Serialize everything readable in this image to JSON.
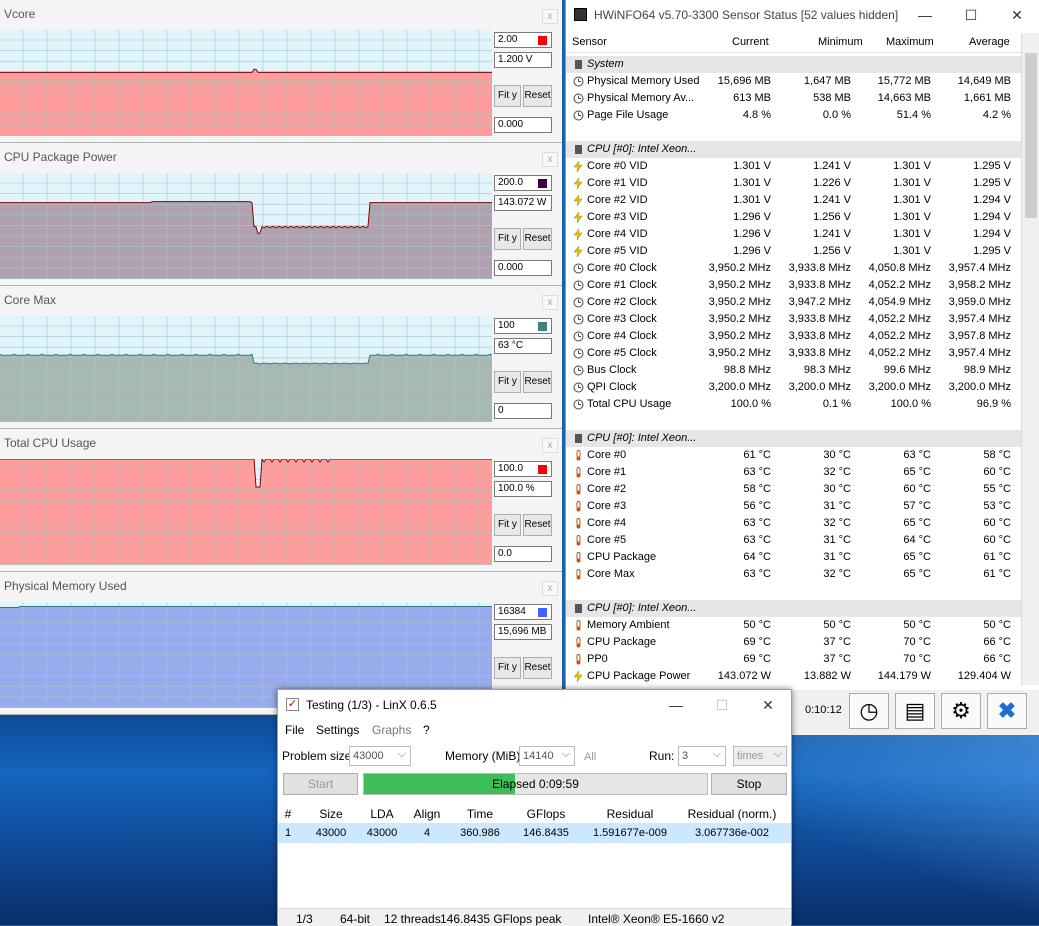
{
  "graphs": [
    {
      "title": "Vcore",
      "max": "2.00",
      "current": "1.200 V",
      "min": "0.000",
      "swatch": "#ff0000",
      "fill": "#ff9c9c",
      "level": 0.6,
      "shape": "vcore"
    },
    {
      "title": "CPU Package Power",
      "max": "200.0",
      "current": "143.072 W",
      "min": "0.000",
      "swatch": "#400040",
      "fill": "#b0a0b0",
      "level": 0.72,
      "shape": "power"
    },
    {
      "title": "Core Max",
      "max": "100",
      "current": "63 °C",
      "min": "0",
      "swatch": "#408080",
      "fill": "#a8b8b0",
      "level": 0.63,
      "shape": "temp"
    },
    {
      "title": "Total CPU Usage",
      "max": "100.0",
      "current": "100.0 %",
      "min": "0.0",
      "swatch": "#ff0000",
      "fill": "#ff9c9c",
      "level": 1.0,
      "shape": "usage"
    },
    {
      "title": "Physical Memory Used",
      "max": "16384",
      "current": "15,696 MB",
      "min": "",
      "swatch": "#4060ff",
      "fill": "#99aaee",
      "level": 0.958,
      "shape": "mem"
    }
  ],
  "graph_buttons": {
    "fit": "Fit y",
    "reset": "Reset",
    "close": "x"
  },
  "hwinfo": {
    "title": "HWiNFO64 v5.70-3300 Sensor Status [52 values hidden]",
    "controls": {
      "min": "—",
      "max": "☐",
      "close": "✕"
    },
    "columns": [
      "Sensor",
      "Current",
      "Minimum",
      "Maximum",
      "Average"
    ],
    "rows": [
      {
        "g": 1,
        "n": "System"
      },
      {
        "i": "clock",
        "n": "Physical Memory Used",
        "c": "15,696 MB",
        "mi": "1,647 MB",
        "ma": "15,772 MB",
        "a": "14,649 MB"
      },
      {
        "i": "clock",
        "n": "Physical Memory Av...",
        "c": "613 MB",
        "mi": "538 MB",
        "ma": "14,663 MB",
        "a": "1,661 MB"
      },
      {
        "i": "clock",
        "n": "Page File Usage",
        "c": "4.8 %",
        "mi": "0.0 %",
        "ma": "51.4 %",
        "a": "4.2 %"
      },
      {
        "e": 1
      },
      {
        "g": 1,
        "n": "CPU [#0]: Intel Xeon..."
      },
      {
        "i": "bolt",
        "n": "Core #0 VID",
        "c": "1.301 V",
        "mi": "1.241 V",
        "ma": "1.301 V",
        "a": "1.295 V"
      },
      {
        "i": "bolt",
        "n": "Core #1 VID",
        "c": "1.301 V",
        "mi": "1.226 V",
        "ma": "1.301 V",
        "a": "1.295 V"
      },
      {
        "i": "bolt",
        "n": "Core #2 VID",
        "c": "1.301 V",
        "mi": "1.241 V",
        "ma": "1.301 V",
        "a": "1.294 V"
      },
      {
        "i": "bolt",
        "n": "Core #3 VID",
        "c": "1.296 V",
        "mi": "1.256 V",
        "ma": "1.301 V",
        "a": "1.294 V"
      },
      {
        "i": "bolt",
        "n": "Core #4 VID",
        "c": "1.296 V",
        "mi": "1.241 V",
        "ma": "1.301 V",
        "a": "1.294 V"
      },
      {
        "i": "bolt",
        "n": "Core #5 VID",
        "c": "1.296 V",
        "mi": "1.256 V",
        "ma": "1.301 V",
        "a": "1.295 V"
      },
      {
        "i": "clock",
        "n": "Core #0 Clock",
        "c": "3,950.2 MHz",
        "mi": "3,933.8 MHz",
        "ma": "4,050.8 MHz",
        "a": "3,957.4 MHz"
      },
      {
        "i": "clock",
        "n": "Core #1 Clock",
        "c": "3,950.2 MHz",
        "mi": "3,933.8 MHz",
        "ma": "4,052.2 MHz",
        "a": "3,958.2 MHz"
      },
      {
        "i": "clock",
        "n": "Core #2 Clock",
        "c": "3,950.2 MHz",
        "mi": "3,947.2 MHz",
        "ma": "4,054.9 MHz",
        "a": "3,959.0 MHz"
      },
      {
        "i": "clock",
        "n": "Core #3 Clock",
        "c": "3,950.2 MHz",
        "mi": "3,933.8 MHz",
        "ma": "4,052.2 MHz",
        "a": "3,957.4 MHz"
      },
      {
        "i": "clock",
        "n": "Core #4 Clock",
        "c": "3,950.2 MHz",
        "mi": "3,933.8 MHz",
        "ma": "4,052.2 MHz",
        "a": "3,957.8 MHz"
      },
      {
        "i": "clock",
        "n": "Core #5 Clock",
        "c": "3,950.2 MHz",
        "mi": "3,933.8 MHz",
        "ma": "4,052.2 MHz",
        "a": "3,957.4 MHz"
      },
      {
        "i": "clock",
        "n": "Bus Clock",
        "c": "98.8 MHz",
        "mi": "98.3 MHz",
        "ma": "99.6 MHz",
        "a": "98.9 MHz"
      },
      {
        "i": "clock",
        "n": "QPI Clock",
        "c": "3,200.0 MHz",
        "mi": "3,200.0 MHz",
        "ma": "3,200.0 MHz",
        "a": "3,200.0 MHz"
      },
      {
        "i": "clock",
        "n": "Total CPU Usage",
        "c": "100.0 %",
        "mi": "0.1 %",
        "ma": "100.0 %",
        "a": "96.9 %"
      },
      {
        "e": 1
      },
      {
        "g": 1,
        "n": "CPU [#0]: Intel Xeon..."
      },
      {
        "i": "therm",
        "n": "Core #0",
        "c": "61 °C",
        "mi": "30 °C",
        "ma": "63 °C",
        "a": "58 °C"
      },
      {
        "i": "therm",
        "n": "Core #1",
        "c": "63 °C",
        "mi": "32 °C",
        "ma": "65 °C",
        "a": "60 °C"
      },
      {
        "i": "therm",
        "n": "Core #2",
        "c": "58 °C",
        "mi": "30 °C",
        "ma": "60 °C",
        "a": "55 °C"
      },
      {
        "i": "therm",
        "n": "Core #3",
        "c": "56 °C",
        "mi": "31 °C",
        "ma": "57 °C",
        "a": "53 °C"
      },
      {
        "i": "therm",
        "n": "Core #4",
        "c": "63 °C",
        "mi": "32 °C",
        "ma": "65 °C",
        "a": "60 °C"
      },
      {
        "i": "therm",
        "n": "Core #5",
        "c": "63 °C",
        "mi": "31 °C",
        "ma": "64 °C",
        "a": "60 °C"
      },
      {
        "i": "therm",
        "n": "CPU Package",
        "c": "64 °C",
        "mi": "31 °C",
        "ma": "65 °C",
        "a": "61 °C"
      },
      {
        "i": "therm",
        "n": "Core Max",
        "c": "63 °C",
        "mi": "32 °C",
        "ma": "65 °C",
        "a": "61 °C"
      },
      {
        "e": 1
      },
      {
        "g": 1,
        "n": "CPU [#0]: Intel Xeon..."
      },
      {
        "i": "therm",
        "n": "Memory Ambient",
        "c": "50 °C",
        "mi": "50 °C",
        "ma": "50 °C",
        "a": "50 °C"
      },
      {
        "i": "therm",
        "n": "CPU Package",
        "c": "69 °C",
        "mi": "37 °C",
        "ma": "70 °C",
        "a": "66 °C"
      },
      {
        "i": "therm",
        "n": "PP0",
        "c": "69 °C",
        "mi": "37 °C",
        "ma": "70 °C",
        "a": "66 °C"
      },
      {
        "i": "bolt",
        "n": "CPU Package Power",
        "c": "143.072 W",
        "mi": "13.882 W",
        "ma": "144.179 W",
        "a": "129.404 W"
      }
    ],
    "timer": "0:10:12"
  },
  "linx": {
    "title": "Testing (1/3) - LinX 0.6.5",
    "menu": [
      "File",
      "Settings",
      "Graphs",
      "?"
    ],
    "problem_label": "Problem size:",
    "problem_value": "43000",
    "memory_label": "Memory (MiB):",
    "memory_value": "14140",
    "all_label": "All",
    "run_label": "Run:",
    "run_value": "3",
    "times_value": "times",
    "start_label": "Start",
    "stop_label": "Stop",
    "elapsed": "Elapsed 0:09:59",
    "progress": 0.44,
    "columns": [
      "#",
      "Size",
      "LDA",
      "Align",
      "Time",
      "GFlops",
      "Residual",
      "Residual (norm.)"
    ],
    "result": [
      "1",
      "43000",
      "43000",
      "4",
      "360.986",
      "146.8435",
      "1.591677e-009",
      "3.067736e-002"
    ],
    "status": [
      "1/3",
      "64-bit",
      "12 threads",
      "146.8435 GFlops peak",
      "Intel® Xeon® E5-1660 v2"
    ],
    "controls": {
      "min": "—",
      "max": "☐",
      "close": "✕"
    }
  }
}
